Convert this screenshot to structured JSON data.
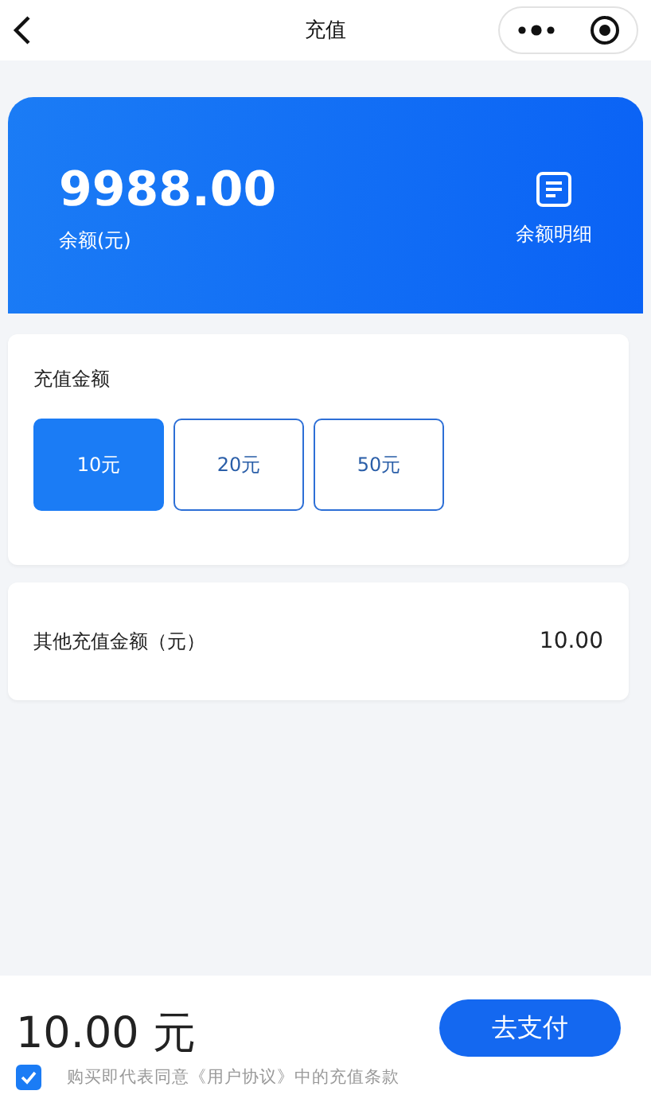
{
  "nav": {
    "title": "充值"
  },
  "balance": {
    "amount": "9988.00",
    "label": "余额(元)",
    "detail_label": "余额明细"
  },
  "recharge": {
    "title": "充值金额",
    "options": [
      {
        "label": "10元",
        "selected": true
      },
      {
        "label": "20元",
        "selected": false
      },
      {
        "label": "50元",
        "selected": false
      }
    ]
  },
  "other": {
    "label": "其他充值金额（元）",
    "value": "10.00"
  },
  "footer": {
    "total": "10.00 元",
    "pay": "去支付",
    "agree_checked": true,
    "agreement": "购买即代表同意《用户协议》中的充值条款"
  }
}
